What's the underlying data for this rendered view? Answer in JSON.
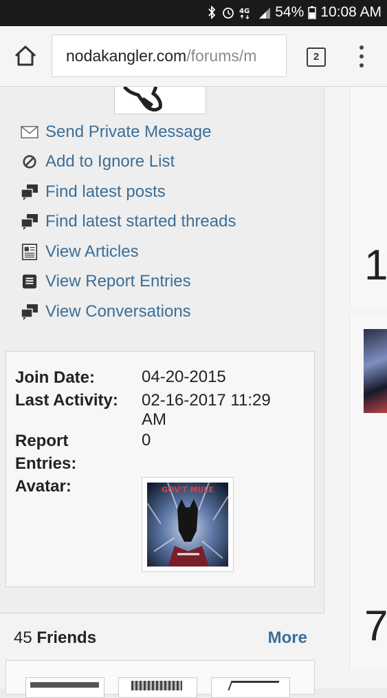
{
  "status_bar": {
    "battery": "54%",
    "time": "10:08 AM",
    "network": "4G",
    "icons": [
      "bluetooth-icon",
      "alarm-icon",
      "lte-icon",
      "signal-icon",
      "battery-icon"
    ]
  },
  "browser": {
    "url_domain": "nodakangler.com",
    "url_path": "/forums/m",
    "tab_count": "2",
    "icons": [
      "home-icon",
      "tabs-icon",
      "overflow-menu-icon"
    ]
  },
  "sidebar": {
    "actions": [
      {
        "label": "Send Private Message",
        "icon": "envelope-icon"
      },
      {
        "label": "Add to Ignore List",
        "icon": "ignore-icon"
      },
      {
        "label": "Find latest posts",
        "icon": "posts-icon"
      },
      {
        "label": "Find latest started threads",
        "icon": "threads-icon"
      },
      {
        "label": "View Articles",
        "icon": "articles-icon"
      },
      {
        "label": "View Report Entries",
        "icon": "report-icon"
      },
      {
        "label": "View Conversations",
        "icon": "conversations-icon"
      }
    ],
    "info": {
      "join_date_label": "Join Date:",
      "join_date_value": "04-20-2015",
      "last_activity_label": "Last Activity:",
      "last_activity_value_line1": "02-16-2017 11:29",
      "last_activity_value_line2": "AM",
      "report_entries_label_line1": "Report",
      "report_entries_label_line2": "Entries:",
      "report_entries_value": "0",
      "avatar_label": "Avatar:",
      "avatar_caption": "GOV'T MULE"
    },
    "friends": {
      "count": "45",
      "label": "Friends",
      "more": "More"
    }
  },
  "main": {
    "numbers": [
      "1",
      "7"
    ]
  },
  "colors": {
    "link": "#3b6e98",
    "status_bar": "#1a1a1a"
  }
}
